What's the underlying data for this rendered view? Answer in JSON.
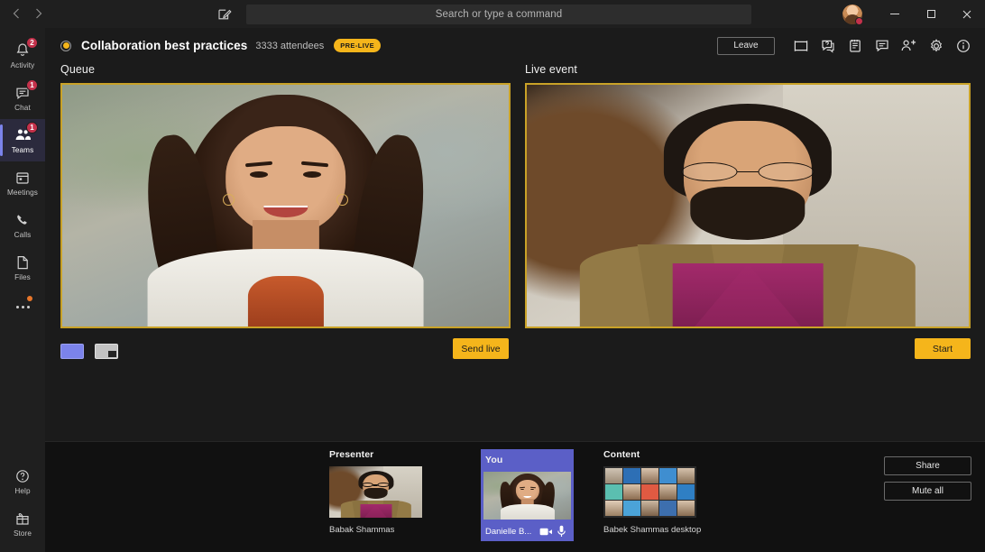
{
  "titlebar": {
    "back_icon": "chevron-left-icon",
    "forward_icon": "chevron-right-icon",
    "compose_icon": "compose-icon",
    "search_placeholder": "Search or type a command",
    "minimize_label": "–",
    "maximize_label": "□",
    "close_label": "✕"
  },
  "rail": {
    "items": [
      {
        "label": "Activity",
        "icon": "bell-icon",
        "badge": "2",
        "active": false
      },
      {
        "label": "Chat",
        "icon": "chat-icon",
        "badge": "1",
        "active": false
      },
      {
        "label": "Teams",
        "icon": "people-icon",
        "badge": "1",
        "active": true
      },
      {
        "label": "Meetings",
        "icon": "calendar-icon",
        "badge": "",
        "active": false
      },
      {
        "label": "Calls",
        "icon": "phone-icon",
        "badge": "",
        "active": false
      },
      {
        "label": "Files",
        "icon": "file-icon",
        "badge": "",
        "active": false
      }
    ],
    "more_icon": "more-ellipsis-icon",
    "bottom": [
      {
        "label": "Help",
        "icon": "help-icon"
      },
      {
        "label": "Store",
        "icon": "store-icon"
      }
    ]
  },
  "event": {
    "recording_indicator": "recording-dot-icon",
    "title": "Collaboration best practices",
    "attendees": "3333 attendees",
    "status_badge": "PRE-LIVE",
    "leave_label": "Leave",
    "toolbar_icons": [
      "screen-layout-icon",
      "qna-icon",
      "notes-icon",
      "chat-icon",
      "add-people-icon",
      "settings-gear-icon",
      "info-icon"
    ]
  },
  "stage": {
    "queue": {
      "title": "Queue",
      "video_alt": "woman-smiling-video",
      "layout_full_icon": "layout-fullscreen-icon",
      "layout_pip_icon": "layout-picture-in-picture-icon",
      "send_live_label": "Send live"
    },
    "live": {
      "title": "Live event",
      "video_alt": "man-with-glasses-video",
      "start_label": "Start"
    }
  },
  "tray": {
    "tiles": [
      {
        "label": "Presenter",
        "name": "Babak Shammas",
        "thumb": "man-with-glasses-thumb"
      },
      {
        "label": "You",
        "name": "Danielle B...",
        "thumb": "woman-smiling-thumb",
        "camera_icon": "camera-icon",
        "mic_icon": "microphone-icon"
      },
      {
        "label": "Content",
        "name": "Babek Shammas desktop",
        "thumb": "desktop-share-thumb"
      }
    ],
    "share_label": "Share",
    "mute_all_label": "Mute all"
  },
  "colors": {
    "accent_amber": "#f5b51b",
    "video_border": "#c9a227",
    "teams_purple": "#5b5fc7",
    "rail_active": "#7b83eb",
    "presence_dnd": "#c4314b",
    "app_bg": "#1b1b1b",
    "tray_bg": "#111111"
  }
}
